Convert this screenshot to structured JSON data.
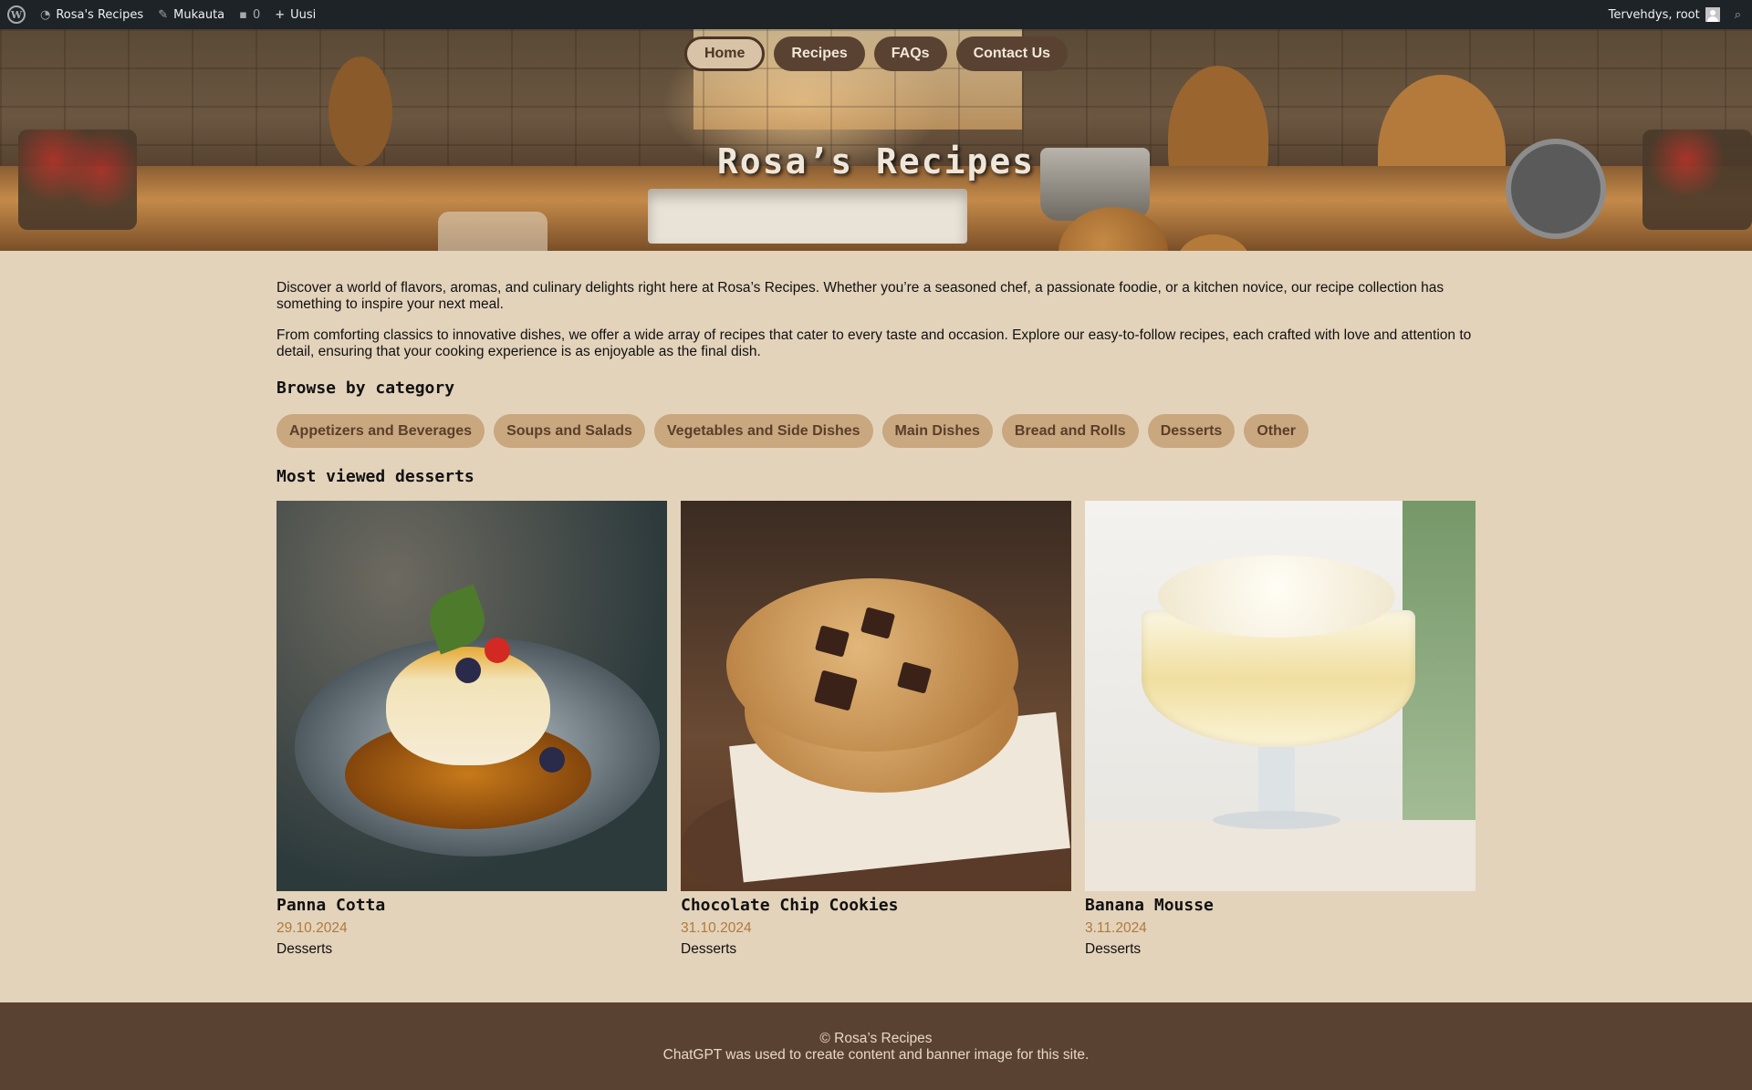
{
  "admin_bar": {
    "site_name": "Rosa's Recipes",
    "edit_label": "Mukauta",
    "comments_count": "0",
    "new_label": "Uusi",
    "greeting": "Tervehdys, root"
  },
  "nav": {
    "items": [
      {
        "label": "Home",
        "active": true
      },
      {
        "label": "Recipes",
        "active": false
      },
      {
        "label": "FAQs",
        "active": false
      },
      {
        "label": "Contact Us",
        "active": false
      }
    ]
  },
  "banner": {
    "title": "Rosa’s Recipes"
  },
  "intro": {
    "p1": "Discover a world of flavors, aromas, and culinary delights right here at Rosa’s Recipes. Whether you’re a seasoned chef, a passionate foodie, or a kitchen novice, our recipe collection has something to inspire your next meal.",
    "p2": "From comforting classics to innovative dishes, we offer a wide array of recipes that cater to every taste and occasion. Explore our easy-to-follow recipes, each crafted with love and attention to detail, ensuring that your cooking experience is as enjoyable as the final dish."
  },
  "categories": {
    "heading": "Browse by category",
    "items": [
      "Appetizers and Beverages",
      "Soups and Salads",
      "Vegetables and Side Dishes",
      "Main Dishes",
      "Bread and Rolls",
      "Desserts",
      "Other"
    ]
  },
  "most_viewed": {
    "heading": "Most viewed desserts",
    "cards": [
      {
        "title": "Panna Cotta",
        "date": "29.10.2024",
        "category": "Desserts"
      },
      {
        "title": "Chocolate Chip Cookies",
        "date": "31.10.2024",
        "category": "Desserts"
      },
      {
        "title": "Banana Mousse",
        "date": "3.11.2024",
        "category": "Desserts"
      }
    ]
  },
  "footer": {
    "copyright": "© Rosa’s Recipes",
    "note": "ChatGPT was used to create content and banner image for this site."
  },
  "colors": {
    "page_bg": "#e3d3bb",
    "nav_bg": "#5a4232",
    "category_bg": "#c9a77f",
    "date_color": "#b07a3c",
    "footer_bg": "#5a4232"
  }
}
